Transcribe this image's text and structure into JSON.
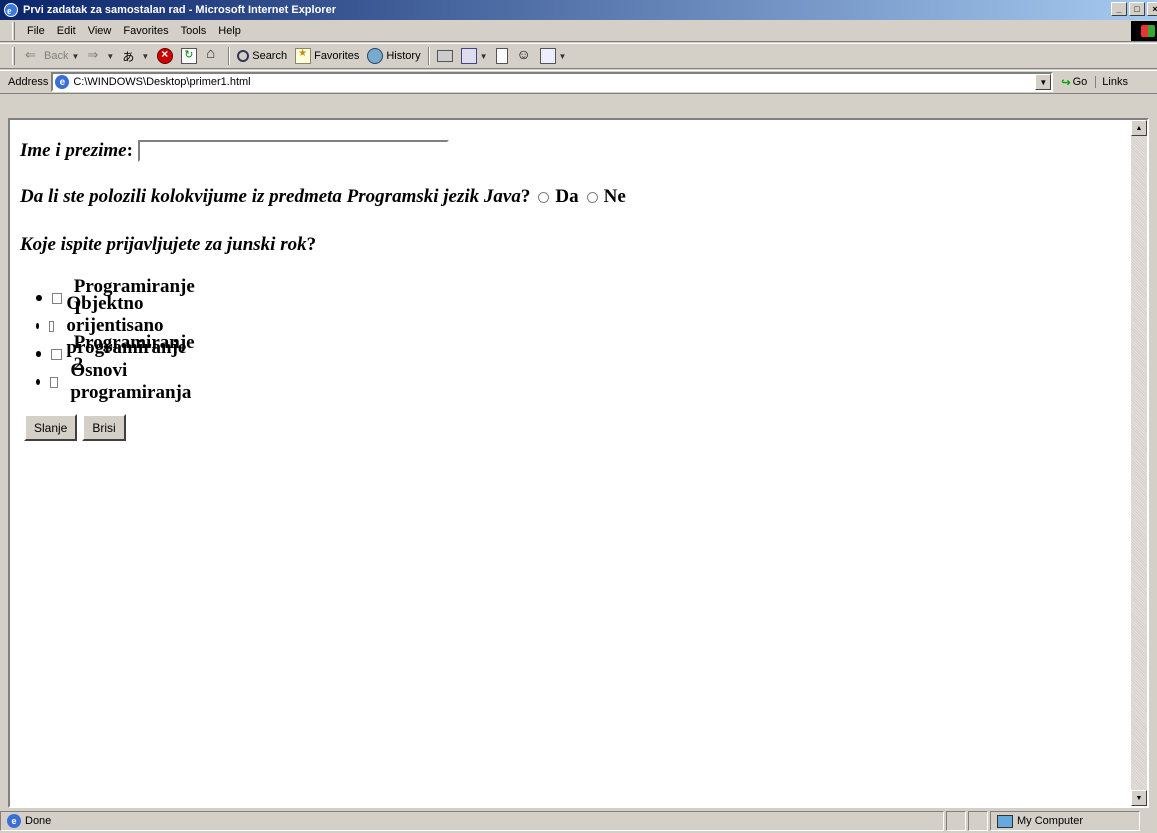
{
  "window": {
    "title": "Prvi zadatak za samostalan rad - Microsoft Internet Explorer",
    "controls": [
      "_",
      "□",
      "×"
    ]
  },
  "menu": [
    "File",
    "Edit",
    "View",
    "Favorites",
    "Tools",
    "Help"
  ],
  "toolbar": {
    "back": "Back",
    "search": "Search",
    "favorites": "Favorites",
    "history": "History"
  },
  "address": {
    "label": "Address",
    "url": "C:\\WINDOWS\\Desktop\\primer1.html",
    "go": "Go",
    "links": "Links"
  },
  "form": {
    "name_label": "Ime i prezime",
    "name_suffix": ":",
    "name_value": "",
    "question1": "Da li ste polozili kolokvijume iz predmeta Programski jezik Java",
    "question1_suffix": "?",
    "option_yes": "Da",
    "option_no": "Ne",
    "question2": "Koje ispite prijavljujete za junski rok",
    "question2_suffix": "?",
    "exams": [
      "Programiranje I",
      "Objektno orijentisano programiranje",
      "Programiranje 2",
      "Osnovi programiranja"
    ],
    "submit_label": "Slanje",
    "reset_label": "Brisi"
  },
  "status": {
    "text": "Done",
    "zone": "My Computer"
  }
}
